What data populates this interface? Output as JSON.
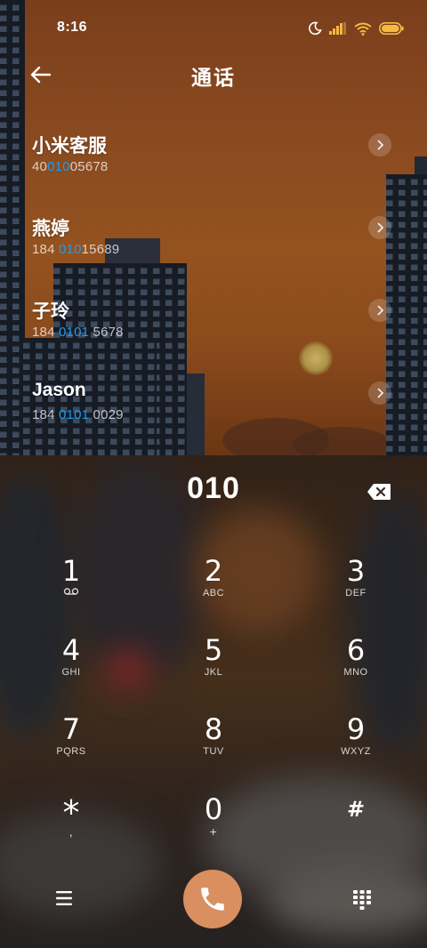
{
  "status_bar": {
    "time": "8:16",
    "icons": [
      "moon-icon",
      "signal-icon",
      "wifi-icon",
      "battery-icon"
    ]
  },
  "header": {
    "title": "通话",
    "back_icon": "arrow-left-icon"
  },
  "contacts": [
    {
      "name": "小米客服",
      "number_pre": "40",
      "number_hl": "010",
      "number_post": "05678"
    },
    {
      "name": "燕婷",
      "number_pre": "184 ",
      "number_hl": "010",
      "number_post": "15689"
    },
    {
      "name": "子玲",
      "number_pre": "184 ",
      "number_hl": "0101",
      "number_post": " 5678"
    },
    {
      "name": "Jason",
      "number_pre": "184 ",
      "number_hl": "0101",
      "number_post": " 0029"
    }
  ],
  "dialer": {
    "input": "010",
    "keys": [
      {
        "digit": "1",
        "sub": ""
      },
      {
        "digit": "2",
        "sub": "ABC"
      },
      {
        "digit": "3",
        "sub": "DEF"
      },
      {
        "digit": "4",
        "sub": "GHI"
      },
      {
        "digit": "5",
        "sub": "JKL"
      },
      {
        "digit": "6",
        "sub": "MNO"
      },
      {
        "digit": "7",
        "sub": "PQRS"
      },
      {
        "digit": "8",
        "sub": "TUV"
      },
      {
        "digit": "9",
        "sub": "WXYZ"
      },
      {
        "digit": "*",
        "sub": ","
      },
      {
        "digit": "0",
        "sub": "+"
      },
      {
        "digit": "#",
        "sub": ""
      }
    ]
  },
  "colors": {
    "highlight": "#1e9bf0",
    "call_button": "#d98f5f",
    "battery": "#f5b942"
  }
}
